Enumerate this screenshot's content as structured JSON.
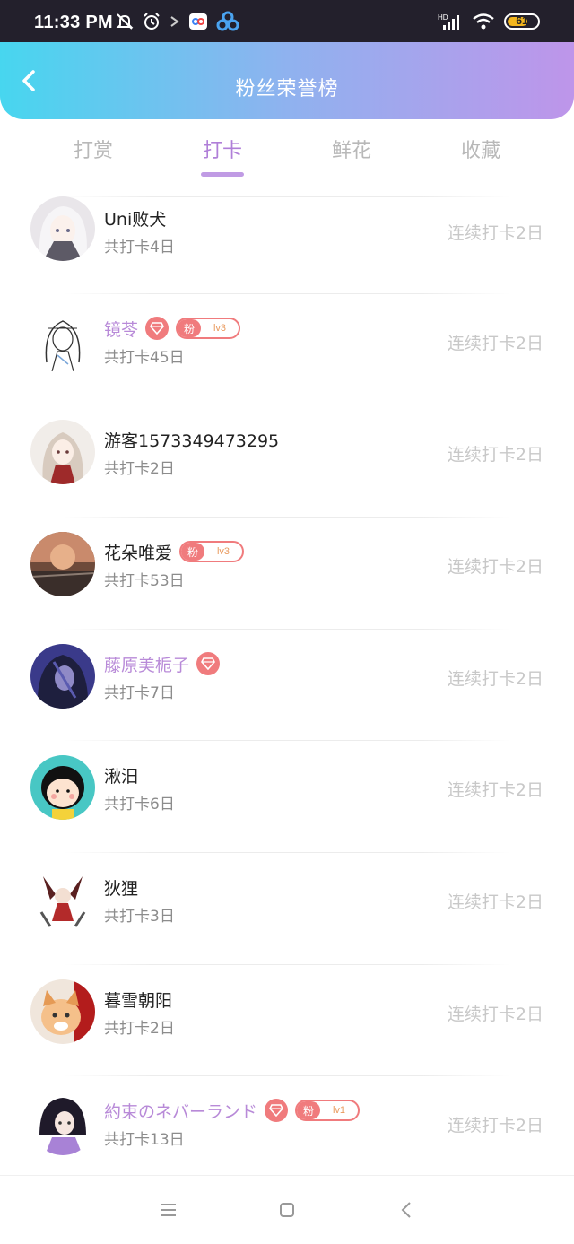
{
  "status_bar": {
    "time": "11:33 PM",
    "battery": "61",
    "icons": [
      "mute-icon",
      "alarm-icon",
      "arrow-icon",
      "app-icon",
      "baidu-icon",
      "hd-signal-icon",
      "wifi-icon",
      "battery-icon"
    ]
  },
  "header": {
    "title": "粉丝荣誉榜",
    "back_icon": "chevron-left-icon"
  },
  "tabs": [
    {
      "label": "打赏",
      "active": false
    },
    {
      "label": "打卡",
      "active": true
    },
    {
      "label": "鲜花",
      "active": false
    },
    {
      "label": "收藏",
      "active": false
    }
  ],
  "colors": {
    "header_gradient": [
      "#47d6ef",
      "#be95ea"
    ],
    "active_tab": "#b07fd8",
    "vip_name": "#b88ad8",
    "badge": "#f07b7d"
  },
  "list": [
    {
      "name": "Uni败犬",
      "vip": false,
      "fan_level": "",
      "total": "共打卡4日",
      "streak": "连续打卡2日",
      "avatar": "anime-white-hair-avatar"
    },
    {
      "name": "镜苓",
      "vip": true,
      "fan_label": "粉",
      "fan_level": "lv3",
      "total": "共打卡45日",
      "streak": "连续打卡2日",
      "avatar": "sketch-girl-avatar"
    },
    {
      "name": "游客1573349473295",
      "vip": false,
      "fan_level": "",
      "total": "共打卡2日",
      "streak": "连续打卡2日",
      "avatar": "anime-girl-red-avatar"
    },
    {
      "name": "花朵唯爱",
      "vip": false,
      "fan_label": "粉",
      "fan_level": "lv3",
      "total": "共打卡53日",
      "streak": "连续打卡2日",
      "avatar": "scenery-avatar"
    },
    {
      "name": "藤原美栀子",
      "vip": true,
      "fan_level": "",
      "total": "共打卡7日",
      "streak": "连续打卡2日",
      "avatar": "dark-anime-avatar"
    },
    {
      "name": "湫汨",
      "vip": false,
      "fan_level": "",
      "total": "共打卡6日",
      "streak": "连续打卡2日",
      "avatar": "cartoon-kid-avatar"
    },
    {
      "name": "狄狸",
      "vip": false,
      "fan_level": "",
      "total": "共打卡3日",
      "streak": "连续打卡2日",
      "avatar": "shrine-maiden-avatar"
    },
    {
      "name": "暮雪朝阳",
      "vip": false,
      "fan_level": "",
      "total": "共打卡2日",
      "streak": "连续打卡2日",
      "avatar": "kitten-avatar"
    },
    {
      "name": "約束のネバーランド",
      "vip": true,
      "fan_label": "粉",
      "fan_level": "lv1",
      "total": "共打卡13日",
      "streak": "连续打卡2日",
      "avatar": "purple-hair-avatar"
    }
  ],
  "nav": [
    "menu-icon",
    "home-icon",
    "back-icon"
  ]
}
